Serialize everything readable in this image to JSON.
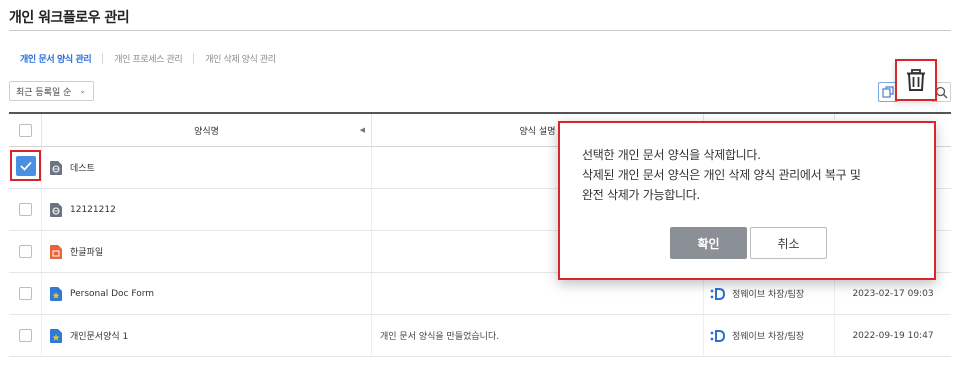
{
  "page": {
    "title": "개인 워크플로우 관리"
  },
  "tabs": [
    {
      "label": "개인 문서 양식 관리",
      "active": true
    },
    {
      "label": "개인 프로세스 관리",
      "active": false
    },
    {
      "label": "개인 삭제 양식 관리",
      "active": false
    }
  ],
  "toolbar": {
    "sort_label": "최근 등록일 순",
    "icons": {
      "copy": "copy-icon",
      "delete": "trash-icon",
      "search": "search-icon"
    }
  },
  "table": {
    "headers": {
      "name": "양식명",
      "description": "양식 설명"
    },
    "rows": [
      {
        "name": "데스트",
        "icon": "globe-doc-icon",
        "description": "",
        "owner": "",
        "date": "",
        "checked": true
      },
      {
        "name": "12121212",
        "icon": "globe-doc-icon",
        "description": "",
        "owner": "",
        "date": "",
        "checked": false
      },
      {
        "name": "한글파일",
        "icon": "hwp-doc-icon",
        "description": "",
        "owner": "",
        "date": "",
        "checked": false
      },
      {
        "name": "Personal Doc Form",
        "icon": "star-doc-icon",
        "description": "",
        "owner": "정웨이브 차장/팀장",
        "date": "2023-02-17 09:03",
        "checked": false
      },
      {
        "name": "개인문서양식 1",
        "icon": "star-doc-icon",
        "description": "개인 문서 양식을 만들었습니다.",
        "owner": "정웨이브 차장/팀장",
        "date": "2022-09-19 10:47",
        "checked": false
      }
    ]
  },
  "dialog": {
    "line1": "선택한 개인 문서 양식을 삭제합니다.",
    "line2": "삭제된 개인 문서 양식은 개인 삭제 양식 관리에서 복구 및",
    "line3": "완전 삭제가 가능합니다.",
    "confirm_label": "확인",
    "cancel_label": "취소"
  },
  "colors": {
    "accent": "#2b6fd6",
    "highlight": "#d7262d",
    "checked": "#4a90e2",
    "hwp": "#e8643a",
    "star_doc": "#2f7ad6"
  }
}
